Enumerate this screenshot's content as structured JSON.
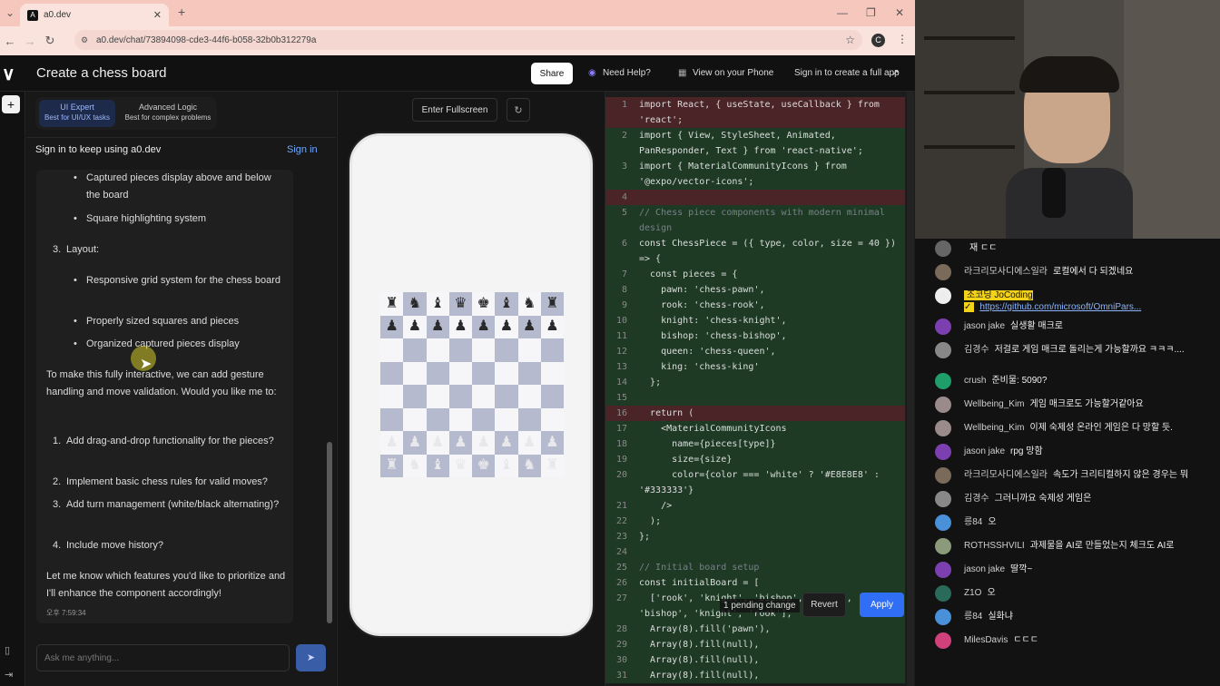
{
  "browser": {
    "tab_title": "a0.dev",
    "url": "a0.dev/chat/73894098-cde3-44f6-b058-32b0b312279a"
  },
  "header": {
    "title": "Create a chess board",
    "share": "Share",
    "need_help": "Need Help?",
    "view_phone": "View on your Phone",
    "sign_in_full": "Sign in to create a full app"
  },
  "modes": [
    {
      "label": "UI Expert",
      "sub": "Best for UI/UX tasks"
    },
    {
      "label": "Advanced Logic",
      "sub": "Best for complex problems"
    }
  ],
  "signin": {
    "text": "Sign in to keep using a0.dev",
    "link": "Sign in"
  },
  "message": {
    "bullets_top": [
      "Captured pieces display above and below the board",
      "Square highlighting system"
    ],
    "layout_heading": "Layout:",
    "layout_num": "3.",
    "layout_bullets": [
      "Responsive grid system for the chess board",
      "Properly sized squares and pieces",
      "Organized captured pieces display"
    ],
    "intro": "To make this fully interactive, we can add gesture handling and move validation. Would you like me to:",
    "options": [
      {
        "n": "1.",
        "t": "Add drag-and-drop functionality for the pieces?"
      },
      {
        "n": "2.",
        "t": "Implement basic chess rules for valid moves?"
      },
      {
        "n": "3.",
        "t": "Add turn management (white/black alternating)?"
      },
      {
        "n": "4.",
        "t": "Include move history?"
      }
    ],
    "outro": "Let me know which features you'd like to prioritize and I'll enhance the component accordingly!",
    "time": "오후 7:59:34"
  },
  "input": {
    "placeholder": "Ask me anything..."
  },
  "preview": {
    "fullscreen": "Enter Fullscreen"
  },
  "board": {
    "rows": [
      [
        "♜",
        "♞",
        "♝",
        "♛",
        "♚",
        "♝",
        "♞",
        "♜"
      ],
      [
        "♟",
        "♟",
        "♟",
        "♟",
        "♟",
        "♟",
        "♟",
        "♟"
      ],
      [
        "",
        "",
        "",
        "",
        "",
        "",
        "",
        ""
      ],
      [
        "",
        "",
        "",
        "",
        "",
        "",
        "",
        ""
      ],
      [
        "",
        "",
        "",
        "",
        "",
        "",
        "",
        ""
      ],
      [
        "",
        "",
        "",
        "",
        "",
        "",
        "",
        ""
      ],
      [
        "♟",
        "♟",
        "♟",
        "♟",
        "♟",
        "♟",
        "♟",
        "♟"
      ],
      [
        "♜",
        "♞",
        "♝",
        "♛",
        "♚",
        "♝",
        "♞",
        "♜"
      ]
    ],
    "dark_color": "#b6bace",
    "light_color": "#f6f6f8"
  },
  "code": {
    "lines": [
      {
        "n": "1",
        "t": "import React, { useState, useCallback } from 'react';",
        "k": "rem",
        "h": 2
      },
      {
        "n": "2",
        "t": "import { View, StyleSheet, Animated, PanResponder, Text } from 'react-native';",
        "k": "add",
        "h": 2
      },
      {
        "n": "3",
        "t": "import { MaterialCommunityIcons } from '@expo/vector-icons';",
        "k": "add",
        "h": 2
      },
      {
        "n": "4",
        "t": "",
        "k": "rem",
        "h": 1
      },
      {
        "n": "5",
        "t": "// Chess piece components with modern minimal design",
        "k": "add",
        "h": 2,
        "c": 1
      },
      {
        "n": "6",
        "t": "const ChessPiece = ({ type, color, size = 40 }) => {",
        "k": "add",
        "h": 2
      },
      {
        "n": "7",
        "t": "  const pieces = {",
        "k": "add",
        "h": 1
      },
      {
        "n": "8",
        "t": "    pawn: 'chess-pawn',",
        "k": "add",
        "h": 1
      },
      {
        "n": "9",
        "t": "    rook: 'chess-rook',",
        "k": "add",
        "h": 1
      },
      {
        "n": "10",
        "t": "    knight: 'chess-knight',",
        "k": "add",
        "h": 1
      },
      {
        "n": "11",
        "t": "    bishop: 'chess-bishop',",
        "k": "add",
        "h": 1
      },
      {
        "n": "12",
        "t": "    queen: 'chess-queen',",
        "k": "add",
        "h": 1
      },
      {
        "n": "13",
        "t": "    king: 'chess-king'",
        "k": "add",
        "h": 1
      },
      {
        "n": "14",
        "t": "  };",
        "k": "add",
        "h": 1
      },
      {
        "n": "15",
        "t": "",
        "k": "add",
        "h": 1
      },
      {
        "n": "16",
        "t": "  return (",
        "k": "rem",
        "h": 1
      },
      {
        "n": "17",
        "t": "    <MaterialCommunityIcons",
        "k": "add",
        "h": 1
      },
      {
        "n": "18",
        "t": "      name={pieces[type]}",
        "k": "add",
        "h": 1
      },
      {
        "n": "19",
        "t": "      size={size}",
        "k": "add",
        "h": 1
      },
      {
        "n": "20",
        "t": "      color={color === 'white' ? '#E8E8E8' : '#333333'}",
        "k": "add",
        "h": 2
      },
      {
        "n": "21",
        "t": "    />",
        "k": "add",
        "h": 1
      },
      {
        "n": "22",
        "t": "  );",
        "k": "add",
        "h": 1
      },
      {
        "n": "23",
        "t": "};",
        "k": "add",
        "h": 1
      },
      {
        "n": "24",
        "t": "",
        "k": "add",
        "h": 1
      },
      {
        "n": "25",
        "t": "// Initial board setup",
        "k": "add",
        "h": 1,
        "c": 1
      },
      {
        "n": "26",
        "t": "const initialBoard = [",
        "k": "add",
        "h": 1
      },
      {
        "n": "27",
        "t": "  ['rook', 'knight', 'bishop', 'queen', 'king', 'bishop', 'knight', 'rook'],",
        "k": "add",
        "h": 2
      },
      {
        "n": "28",
        "t": "  Array(8).fill('pawn'),",
        "k": "add",
        "h": 1
      },
      {
        "n": "29",
        "t": "  Array(8).fill(null),",
        "k": "add",
        "h": 1
      },
      {
        "n": "30",
        "t": "  Array(8).fill(null),",
        "k": "add",
        "h": 1
      },
      {
        "n": "31",
        "t": "  Array(8).fill(null),",
        "k": "add",
        "h": 1
      }
    ],
    "pending": "1 pending change",
    "revert": "Revert",
    "apply": "Apply"
  },
  "live_chat": [
    {
      "nick": "",
      "text": "재 ㄷㄷ",
      "av": "#666"
    },
    {
      "nick": "라크리모사디에스일라",
      "text": "로컬에서 다 되겠네요",
      "av": "#7a6a5a"
    },
    {
      "nick": "조코딩 JoCoding ✓",
      "text": "https://github.com/microsoft/OmniPars...",
      "av": "#eee",
      "link": 1
    },
    {
      "nick": "jason jake",
      "text": "실생활 매크로",
      "av": "#7b3fb0"
    },
    {
      "nick": "김경수",
      "text": "저걸로 게임 매크로 돌리는게 가능할까요 ㅋㅋㅋ....",
      "av": "#888"
    },
    {
      "nick": "crush",
      "text": "준비물: 5090?",
      "av": "#1f9d6a"
    },
    {
      "nick": "Wellbeing_Kim",
      "text": "게임 매크로도 가능할거같아요",
      "av": "#9a8a8a"
    },
    {
      "nick": "Wellbeing_Kim",
      "text": "이제 숙제성 온라인 게임은 다 망할 듯.",
      "av": "#9a8a8a"
    },
    {
      "nick": "jason jake",
      "text": "rpg 망함",
      "av": "#7b3fb0"
    },
    {
      "nick": "라크리모사디에스일라",
      "text": "속도가 크리티컬하지 않은 경우는 뭐",
      "av": "#7a6a5a"
    },
    {
      "nick": "김경수",
      "text": "그러니까요 숙제성 게임은",
      "av": "#888"
    },
    {
      "nick": "릉84",
      "text": "오",
      "av": "#4a90d9"
    },
    {
      "nick": "ROTHSSHVILI",
      "text": "과제물을 AI로 만들었는지 체크도 AI로",
      "av": "#8a9a7a"
    },
    {
      "nick": "jason jake",
      "text": "딸깍~",
      "av": "#7b3fb0"
    },
    {
      "nick": "Z1O",
      "text": "오",
      "av": "#2a6a5a"
    },
    {
      "nick": "릉84",
      "text": "실화냐",
      "av": "#4a90d9"
    },
    {
      "nick": "MilesDavis",
      "text": "ㄷㄷㄷ",
      "av": "#d0407a"
    }
  ]
}
